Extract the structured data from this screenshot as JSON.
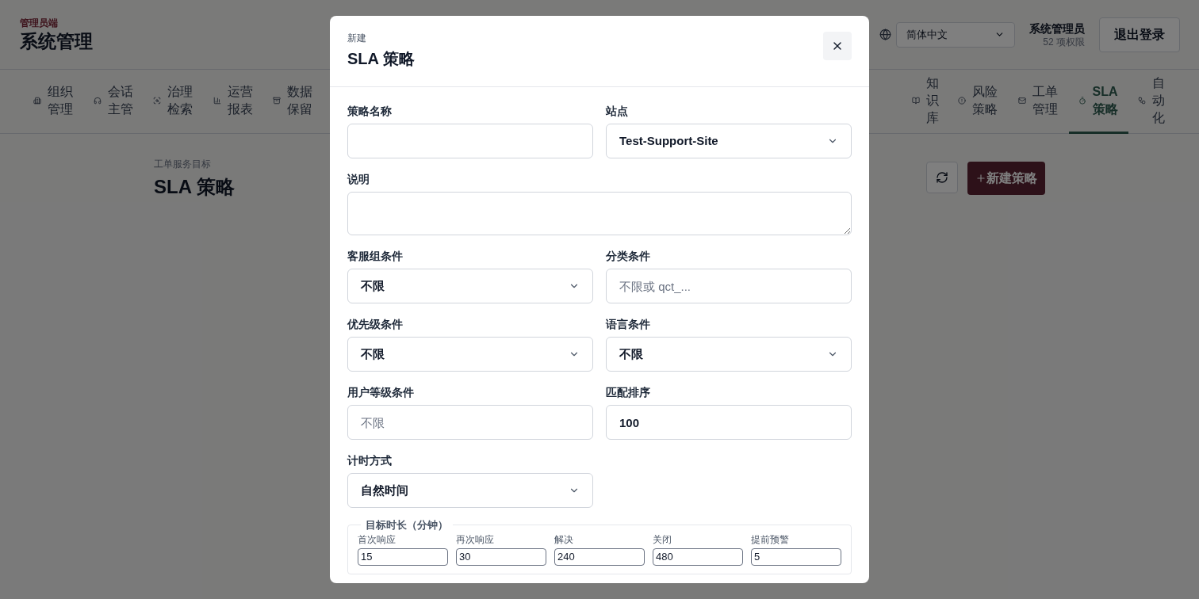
{
  "header": {
    "eyebrow": "管理员端",
    "title": "系统管理",
    "language": {
      "value": "简体中文"
    },
    "user": {
      "name": "系统管理员",
      "permissions": "52 项权限"
    },
    "logout": "退出登录"
  },
  "tab_groups": [
    [
      {
        "label": "组织管理",
        "selected": false
      },
      {
        "label": "会话主管",
        "selected": false
      },
      {
        "label": "治理检索",
        "selected": false
      },
      {
        "label": "运营报表",
        "selected": false
      },
      {
        "label": "数据保留",
        "selected": false
      }
    ],
    [
      {
        "label": "知识库",
        "selected": false
      },
      {
        "label": "风险策略",
        "selected": false
      },
      {
        "label": "工单管理",
        "selected": false
      },
      {
        "label": "SLA 策略",
        "selected": true
      },
      {
        "label": "自动化",
        "selected": false
      }
    ]
  ],
  "page": {
    "eyebrow": "工单服务目标",
    "title": "SLA 策略",
    "new_button": "新建策略"
  },
  "dialog": {
    "eyebrow": "新建",
    "title": "SLA 策略",
    "rows": [
      [
        {
          "label": "策略名称",
          "kind": "text"
        },
        {
          "label": "站点",
          "kind": "select",
          "value": "Test-Support-Site"
        }
      ],
      [
        {
          "label": "说明",
          "kind": "textarea"
        }
      ],
      [
        {
          "label": "客服组条件",
          "kind": "select",
          "value": "不限"
        },
        {
          "label": "分类条件",
          "kind": "text",
          "placeholder": "不限或 qct_..."
        }
      ],
      [
        {
          "label": "优先级条件",
          "kind": "select",
          "value": "不限"
        },
        {
          "label": "语言条件",
          "kind": "select",
          "value": "不限"
        }
      ],
      [
        {
          "label": "用户等级条件",
          "kind": "text",
          "placeholder": "不限"
        },
        {
          "label": "匹配排序",
          "kind": "text",
          "value": "100"
        }
      ],
      [
        {
          "label": "计时方式",
          "kind": "select",
          "value": "自然时间"
        }
      ]
    ],
    "targets": {
      "legend": "目标时长（分钟）",
      "fields": [
        {
          "label": "首次响应",
          "value": "15"
        },
        {
          "label": "再次响应",
          "value": "30"
        },
        {
          "label": "解决",
          "value": "240"
        },
        {
          "label": "关闭",
          "value": "480"
        },
        {
          "label": "提前预警",
          "value": "5"
        }
      ]
    }
  }
}
